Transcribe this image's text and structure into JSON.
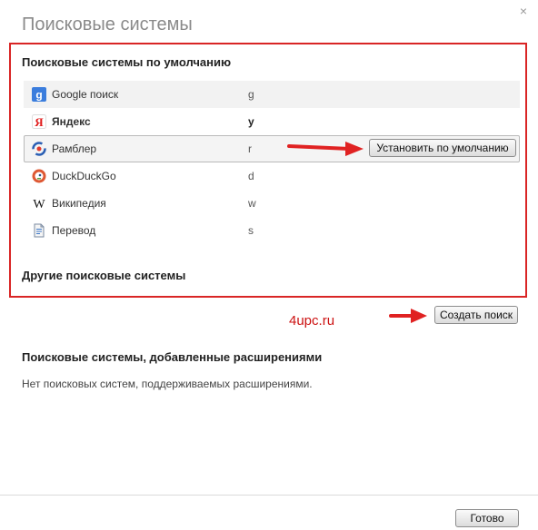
{
  "dialog": {
    "title": "Поисковые системы",
    "close_label": "×"
  },
  "default_section": {
    "heading": "Поисковые системы по умолчанию",
    "engines": [
      {
        "name": "Google поиск",
        "keyword": "g",
        "icon": "google-icon",
        "bold": false
      },
      {
        "name": "Яндекс",
        "keyword": "y",
        "icon": "yandex-icon",
        "bold": true
      },
      {
        "name": "Рамблер",
        "keyword": "r",
        "icon": "rambler-icon",
        "bold": false
      },
      {
        "name": "DuckDuckGo",
        "keyword": "d",
        "icon": "duckduckgo-icon",
        "bold": false
      },
      {
        "name": "Википедия",
        "keyword": "w",
        "icon": "wikipedia-icon",
        "bold": false
      },
      {
        "name": "Перевод",
        "keyword": "s",
        "icon": "translate-icon",
        "bold": false
      }
    ],
    "set_default_label": "Установить по умолчанию"
  },
  "other_section": {
    "heading": "Другие поисковые системы",
    "create_label": "Создать поиск"
  },
  "watermark": "4upc.ru",
  "extensions_section": {
    "heading": "Поисковые системы, добавленные расширениями",
    "empty_text": "Нет поисковых систем, поддерживаемых расширениями."
  },
  "footer": {
    "done_label": "Готово"
  },
  "colors": {
    "annotation_red": "#d92525",
    "title_gray": "#8a8a8a"
  }
}
